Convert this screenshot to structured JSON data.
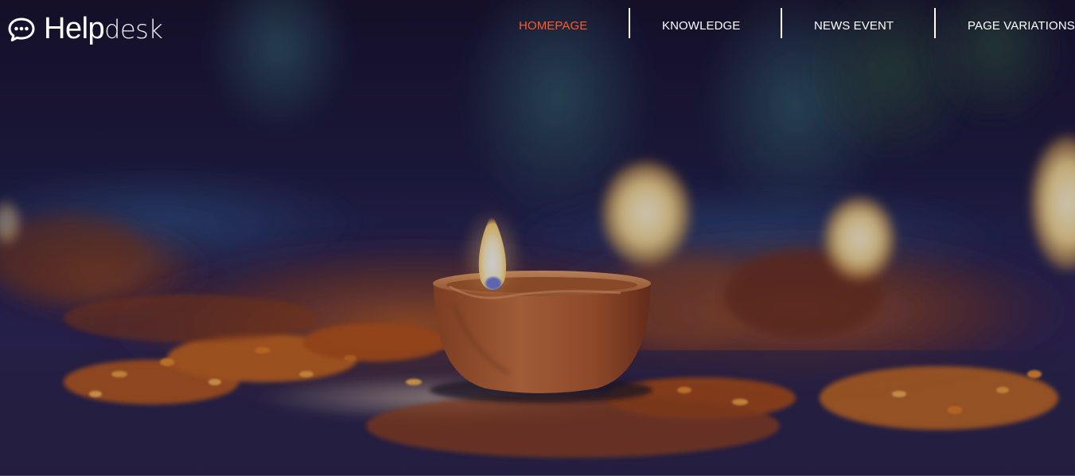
{
  "brand": {
    "name_bold": "Help",
    "name_light": "desk",
    "icon": "chat-bubble-icon"
  },
  "nav": {
    "items": [
      {
        "label": "HOMEPAGE",
        "active": true
      },
      {
        "label": "KNOWLEDGE",
        "active": false
      },
      {
        "label": "NEWS EVENT",
        "active": false
      },
      {
        "label": "PAGE VARIATIONS",
        "active": false
      }
    ]
  },
  "colors": {
    "accent": "#ff5a2c",
    "nav_text": "#ffffff",
    "overlay": "#1a1430"
  },
  "hero": {
    "image": "diya-oil-lamp-photo"
  }
}
